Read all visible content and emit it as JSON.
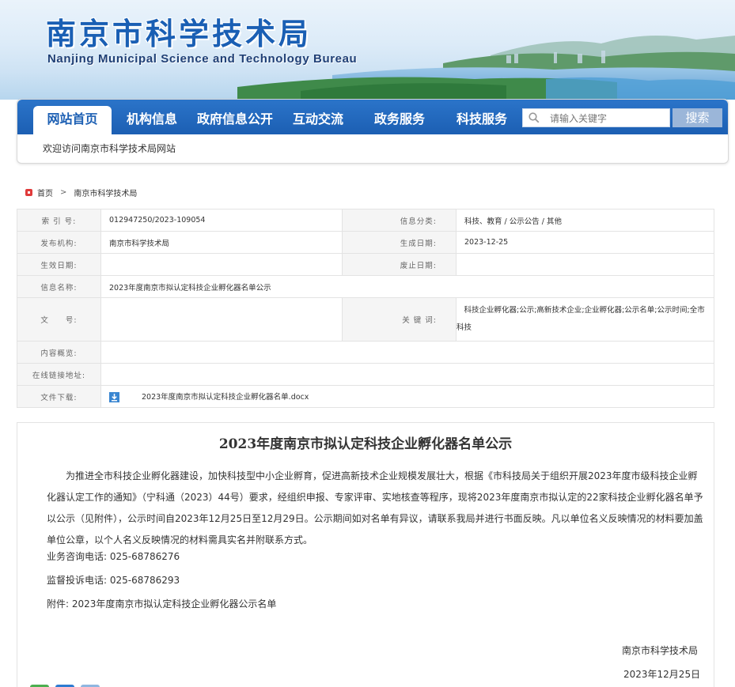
{
  "header": {
    "title": "南京市科学技术局",
    "subtitle": "Nanjing Municipal Science and Technology Bureau"
  },
  "nav": {
    "items": [
      {
        "label": "网站首页",
        "active": true
      },
      {
        "label": "机构信息"
      },
      {
        "label": "政府信息公开"
      },
      {
        "label": "互动交流"
      },
      {
        "label": "政务服务"
      },
      {
        "label": "科技服务"
      }
    ],
    "search_placeholder": "请输入关键字",
    "search_button": "搜索",
    "search_icon": "search-icon"
  },
  "welcome": "欢迎访问南京市科学技术局网站",
  "breadcrumb": {
    "home": "首页",
    "separator": ">",
    "current": "南京市科学技术局"
  },
  "meta": {
    "index_label": "索 引 号:",
    "index_value": "012947250/2023-109054",
    "category_label": "信息分类:",
    "category_value": "科技、教育 / 公示公告 / 其他",
    "publisher_label": "发布机构:",
    "publisher_value": "南京市科学技术局",
    "created_label": "生成日期:",
    "created_value": "2023-12-25",
    "effective_label": "生效日期:",
    "effective_value": "",
    "expire_label": "废止日期:",
    "expire_value": "",
    "name_label": "信息名称:",
    "name_value": "2023年度南京市拟认定科技企业孵化器名单公示",
    "docno_label": "文　　号:",
    "docno_value": "",
    "keywords_label": "关 键 词:",
    "keywords_value": "科技企业孵化器;公示;高新技术企业;企业孵化器;公示名单;公示时间;全市科技",
    "summary_label": "内容概览:",
    "summary_value": "",
    "link_label": "在线链接地址:",
    "link_value": "",
    "download_label": "文件下载:",
    "download_file": "2023年度南京市拟认定科技企业孵化器名单.docx"
  },
  "article": {
    "title": "2023年度南京市拟认定科技企业孵化器名单公示",
    "paragraph": "为推进全市科技企业孵化器建设，加快科技型中小企业孵育，促进高新技术企业规模发展壮大，根据《市科技局关于组织开展2023年度市级科技企业孵化器认定工作的通知》（宁科通（2023）44号）要求，经组织申报、专家评审、实地核查等程序，现将2023年度南京市拟认定的22家科技企业孵化器名单予以公示（见附件），公示时间自2023年12月25日至12月29日。公示期间如对名单有异议，请联系我局并进行书面反映。凡以单位名义反映情况的材料要加盖单位公章，以个人名义反映情况的材料需具实名并附联系方式。",
    "consult_phone": "业务咨询电话: 025-68786276",
    "complaint_phone": "监督投诉电话: 025-68786293",
    "attachment": "附件: 2023年度南京市拟认定科技企业孵化器公示名单",
    "signer": "南京市科学技术局",
    "date": "2023年12月25日"
  },
  "colors": {
    "brand_blue": "#1c5fb3",
    "title_blue": "#1a5fb4"
  }
}
